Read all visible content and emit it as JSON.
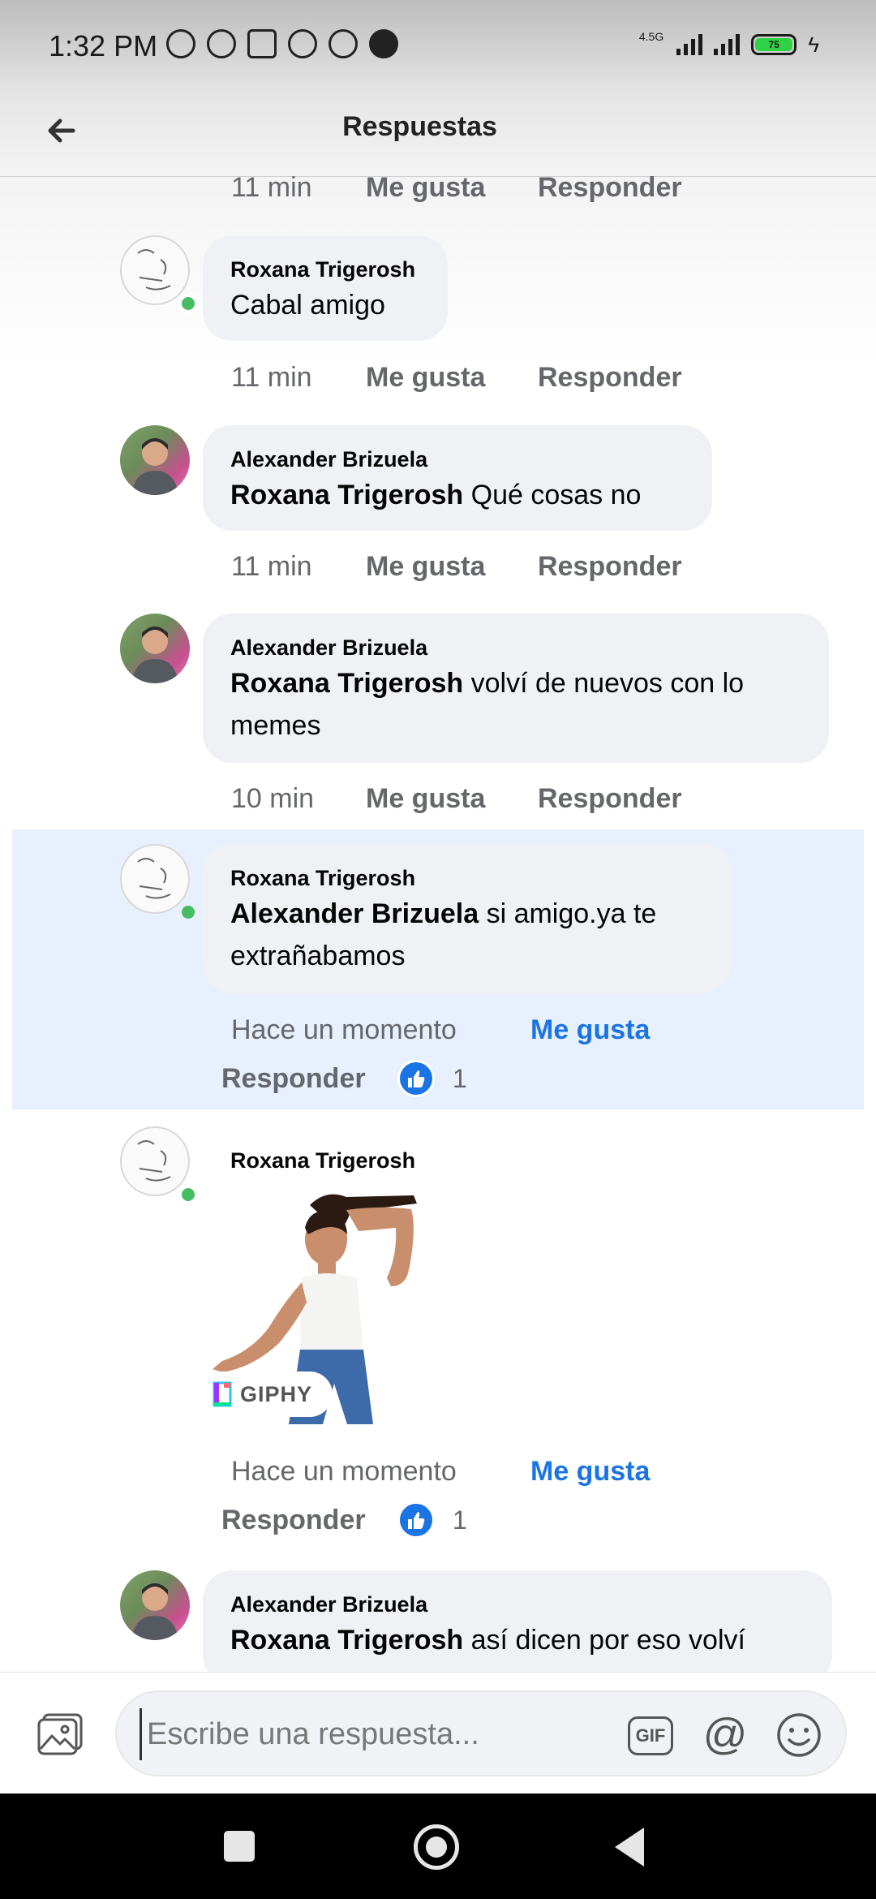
{
  "status_bar": {
    "time": "1:32 PM",
    "network_label": "4.5G",
    "battery": "75",
    "icons": [
      "mute-icon",
      "alarm-icon",
      "nfc-icon",
      "whatsapp-icon",
      "facebook-icon",
      "facebook-icon"
    ]
  },
  "header": {
    "title": "Respuestas"
  },
  "thread": {
    "first_meta": {
      "time": "11 min",
      "like": "Me gusta",
      "reply": "Responder"
    },
    "comments": [
      {
        "author": "Roxana Trigerosh",
        "mention": "",
        "text": "Cabal amigo",
        "time": "11 min",
        "like": "Me gusta",
        "reply": "Responder",
        "online": true
      },
      {
        "author": "Alexander Brizuela",
        "mention": "Roxana Trigerosh",
        "text": " Qué cosas no",
        "time": "11 min",
        "like": "Me gusta",
        "reply": "Responder",
        "online": false
      },
      {
        "author": "Alexander Brizuela",
        "mention": "Roxana Trigerosh",
        "text_line1": " volví de nuevos con lo",
        "text_line2": "memes",
        "time": "10 min",
        "like": "Me gusta",
        "reply": "Responder",
        "online": false
      },
      {
        "author": "Roxana Trigerosh",
        "mention": "Alexander Brizuela",
        "text_line1": " si amigo.ya te",
        "text_line2": "extrañabamos",
        "time": "Hace un momento",
        "like": "Me gusta",
        "reply": "Responder",
        "like_count": "1",
        "online": true,
        "highlighted": true
      },
      {
        "author": "Roxana Trigerosh",
        "gif_label": "GIPHY",
        "time": "Hace un momento",
        "like": "Me gusta",
        "reply": "Responder",
        "like_count": "1",
        "online": true
      },
      {
        "author": "Alexander Brizuela",
        "mention": "Roxana Trigerosh",
        "text": " así dicen por eso volví",
        "online": false
      }
    ]
  },
  "composer": {
    "placeholder": "Escribe una respuesta...",
    "gif_label": "GIF",
    "at_label": "@"
  },
  "colors": {
    "accent_blue": "#1b74e4",
    "online_green": "#45bd62",
    "bubble_bg": "#eff1f4",
    "highlight_bg": "#e7f0fc",
    "meta_gray": "#65676b"
  }
}
